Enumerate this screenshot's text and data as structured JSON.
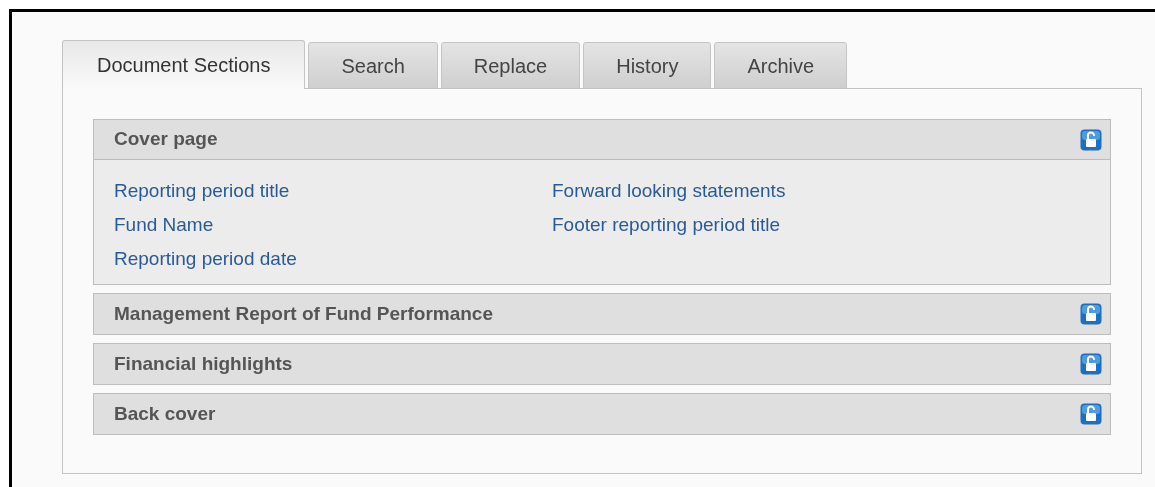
{
  "tabs": [
    {
      "label": "Document Sections",
      "selected": true
    },
    {
      "label": "Search",
      "selected": false
    },
    {
      "label": "Replace",
      "selected": false
    },
    {
      "label": "History",
      "selected": false
    },
    {
      "label": "Archive",
      "selected": false
    }
  ],
  "sections": [
    {
      "title": "Cover page",
      "expanded": true,
      "links": [
        "Reporting period title",
        "Fund Name",
        "Reporting period date",
        "Forward looking statements",
        "Footer reporting period title"
      ]
    },
    {
      "title": "Management Report of Fund Performance",
      "expanded": false
    },
    {
      "title": "Financial highlights",
      "expanded": false
    },
    {
      "title": "Back cover",
      "expanded": false
    }
  ]
}
